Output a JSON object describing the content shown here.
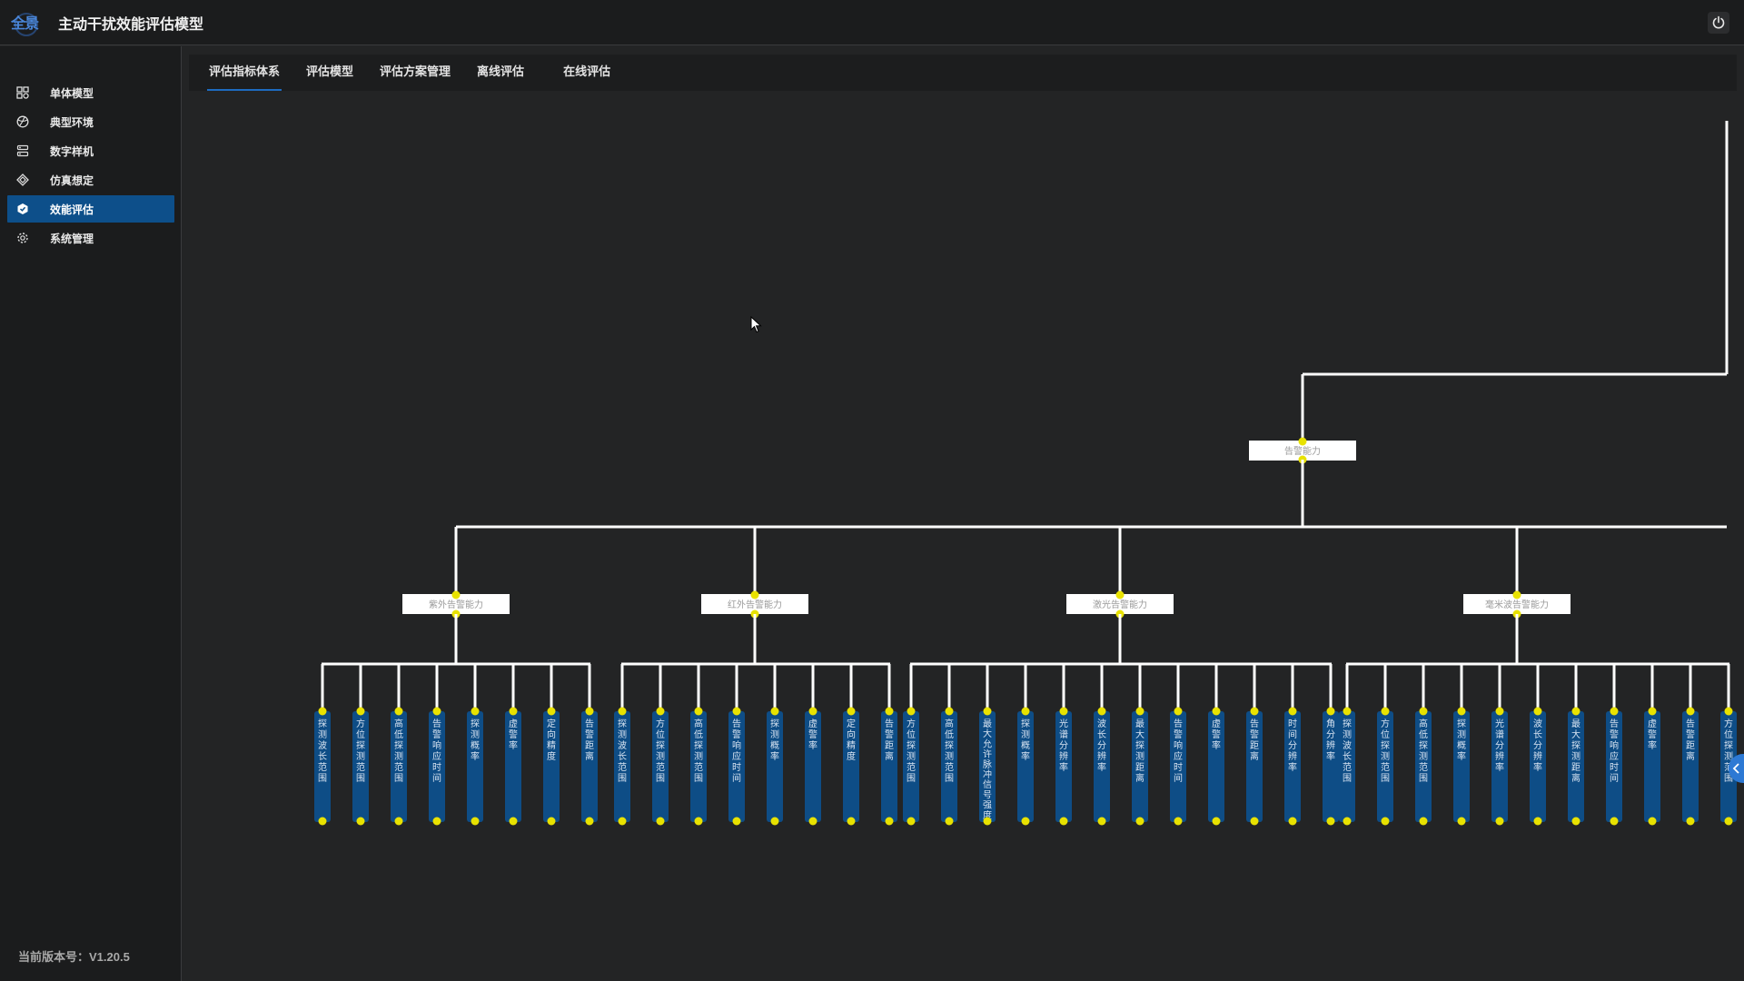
{
  "app": {
    "title": "主动干扰效能评估模型",
    "logo_text": "全景"
  },
  "sidebar": {
    "items": [
      {
        "label": "单体模型",
        "icon": "grid-icon"
      },
      {
        "label": "典型环境",
        "icon": "globe-icon"
      },
      {
        "label": "数字样机",
        "icon": "server-icon"
      },
      {
        "label": "仿真想定",
        "icon": "diamond-icon"
      },
      {
        "label": "效能评估",
        "icon": "check-shield-icon",
        "active": true
      },
      {
        "label": "系统管理",
        "icon": "gear-icon"
      }
    ],
    "version": "当前版本号：V1.20.5"
  },
  "tabs": [
    {
      "label": "评估指标体系",
      "active": true
    },
    {
      "label": "评估模型"
    },
    {
      "label": "评估方案管理"
    },
    {
      "label": "离线评估"
    },
    {
      "label": "在线评估"
    }
  ],
  "tree": {
    "root": "告警能力",
    "groups": [
      {
        "label": "紫外告警能力",
        "leaves": [
          "探测波长范围",
          "方位探测范围",
          "高低探测范围",
          "告警响应时间",
          "探测概率",
          "虚警率",
          "定向精度",
          "告警距离"
        ]
      },
      {
        "label": "红外告警能力",
        "leaves": [
          "探测波长范围",
          "方位探测范围",
          "高低探测范围",
          "告警响应时间",
          "探测概率",
          "虚警率",
          "定向精度",
          "告警距离"
        ]
      },
      {
        "label": "激光告警能力",
        "leaves": [
          "方位探测范围",
          "高低探测范围",
          "最大允许脉冲信号强度",
          "探测概率",
          "光谱分辨率",
          "波长分辨率",
          "最大探测距离",
          "告警响应时间",
          "虚警率",
          "告警距离",
          "时间分辨率",
          "角分辨率"
        ]
      },
      {
        "label": "毫米波告警能力",
        "leaves": [
          "探测波长范围",
          "方位探测范围",
          "高低探测范围",
          "探测概率",
          "光谱分辨率",
          "波长分辨率",
          "最大探测距离",
          "告警响应时间",
          "虚警率",
          "告警距离",
          "方位探测范围"
        ]
      }
    ]
  },
  "colors": {
    "accent": "#0d4f8a",
    "node_dot": "#e8e200",
    "leaf_bg": "#0e4d86",
    "line": "#ffffff"
  }
}
